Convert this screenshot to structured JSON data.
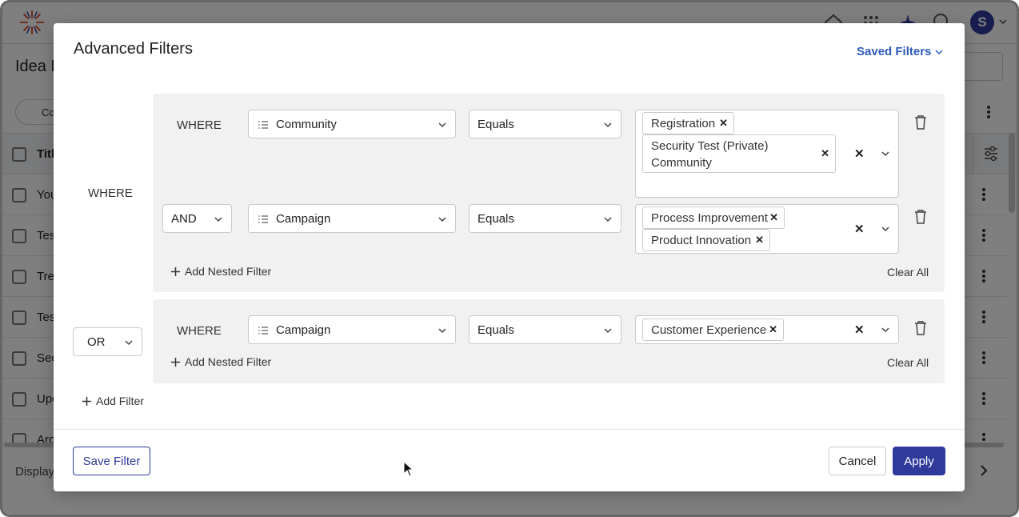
{
  "background": {
    "page_title": "Idea P",
    "chip_label": "Co",
    "table_header": "Titl",
    "rows": [
      "You",
      "Tes",
      "Tre",
      "Tes",
      "Sec",
      "Upd",
      "Arc"
    ],
    "footer_text": "Display",
    "avatar_initial": "S"
  },
  "modal": {
    "title": "Advanced Filters",
    "saved_filters_label": "Saved Filters",
    "outer_where_label": "WHERE",
    "groups": [
      {
        "connector": "",
        "filters": [
          {
            "label": "WHERE",
            "field": "Community",
            "operator": "Equals",
            "values": [
              "Registration",
              "Security Test (Private) Community"
            ]
          },
          {
            "label": "AND",
            "field": "Campaign",
            "operator": "Equals",
            "values": [
              "Process Improvement",
              "Product Innovation"
            ]
          }
        ],
        "add_nested_label": "Add Nested Filter",
        "clear_all_label": "Clear All"
      },
      {
        "connector": "OR",
        "filters": [
          {
            "label": "WHERE",
            "field": "Campaign",
            "operator": "Equals",
            "values": [
              "Customer Experience"
            ]
          }
        ],
        "add_nested_label": "Add Nested Filter",
        "clear_all_label": "Clear All"
      }
    ],
    "add_filter_label": "Add Filter",
    "save_filter_label": "Save Filter",
    "cancel_label": "Cancel",
    "apply_label": "Apply"
  },
  "colors": {
    "primary": "#2f3a9a",
    "link": "#2f5bbf",
    "group_bg": "#f1f1f2"
  },
  "icons": [
    "logo-icon",
    "home-icon",
    "apps-grid-icon",
    "sparkle-icon",
    "search-icon",
    "list-icon",
    "chevron-down-icon",
    "close-icon",
    "trash-icon",
    "plus-icon",
    "kebab-icon",
    "column-settings-icon",
    "chevron-right-icon",
    "mouse-cursor-icon"
  ]
}
